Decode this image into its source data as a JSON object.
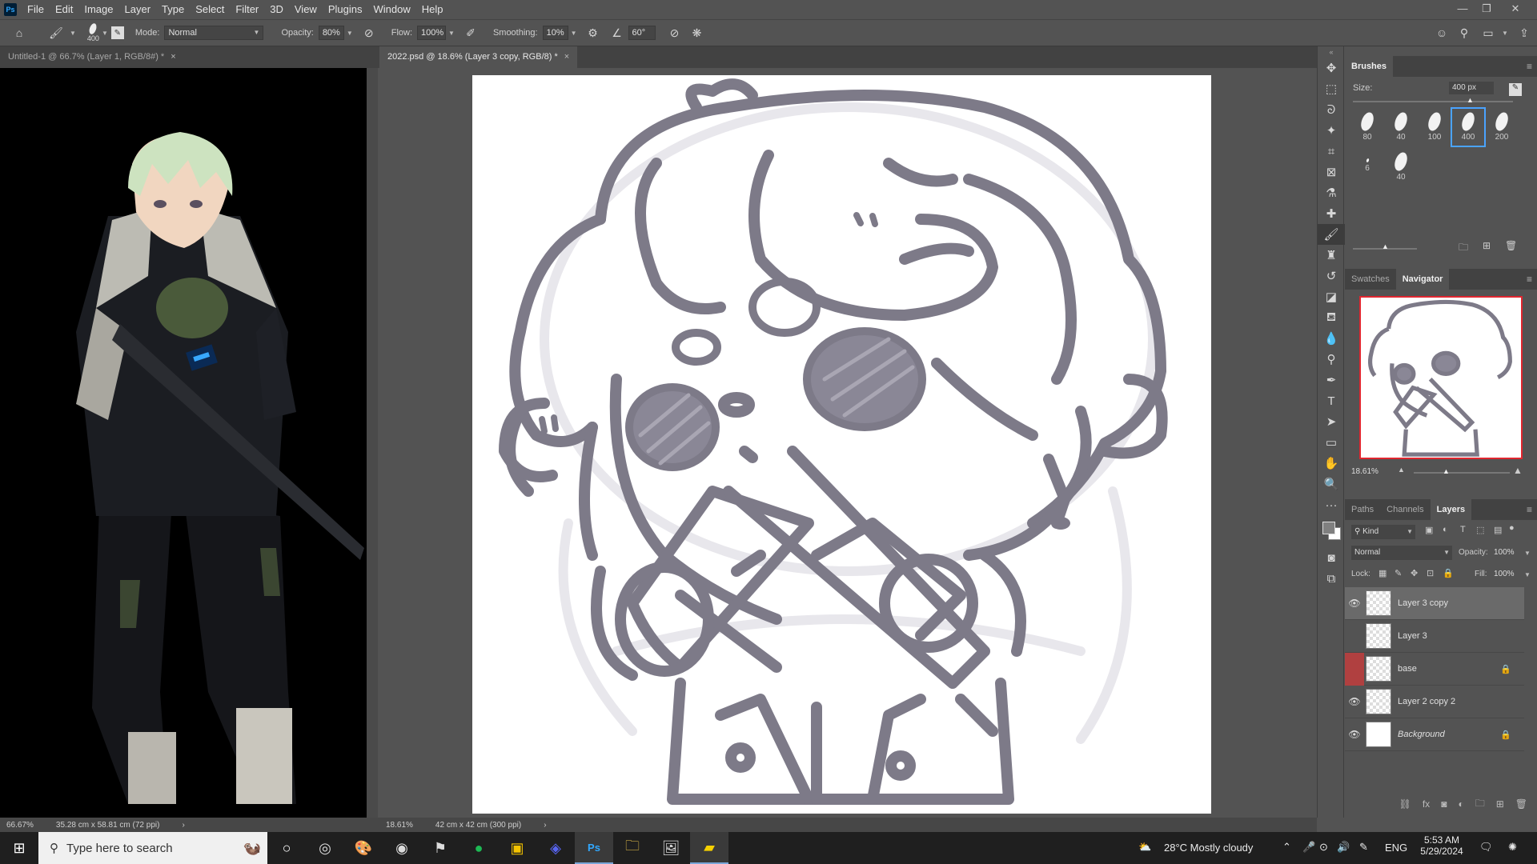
{
  "menubar": {
    "logo": "Ps",
    "items": [
      "File",
      "Edit",
      "Image",
      "Layer",
      "Type",
      "Select",
      "Filter",
      "3D",
      "View",
      "Plugins",
      "Window",
      "Help"
    ],
    "window_controls": [
      "—",
      "❐",
      "✕"
    ]
  },
  "options": {
    "brush_size": "400",
    "mode_label": "Mode:",
    "mode_value": "Normal",
    "opacity_label": "Opacity:",
    "opacity_value": "80%",
    "flow_label": "Flow:",
    "flow_value": "100%",
    "smoothing_label": "Smoothing:",
    "smoothing_value": "10%",
    "angle_value": "60°"
  },
  "tabs": [
    {
      "label": "Untitled-1 @ 66.7% (Layer 1, RGB/8#) *",
      "close": "×"
    },
    {
      "label": "2022.psd @ 18.6% (Layer 3 copy, RGB/8) *",
      "close": "×"
    }
  ],
  "status_left": {
    "zoom": "66.67%",
    "info": "35.28 cm x 58.81 cm (72 ppi)",
    "arrow": "›"
  },
  "status_center": {
    "zoom": "18.61%",
    "info": "42 cm x 42 cm (300 ppi)",
    "arrow": "›"
  },
  "brushes": {
    "title": "Brushes",
    "size_label": "Size:",
    "size_value": "400 px",
    "tips": [
      "80",
      "40",
      "100",
      "400",
      "200",
      "6",
      "40"
    ]
  },
  "navigator": {
    "tabs": [
      "Swatches",
      "Navigator"
    ],
    "zoom": "18.61%"
  },
  "layers": {
    "tabs": [
      "Paths",
      "Channels",
      "Layers"
    ],
    "filter_label": "Kind",
    "blend_mode": "Normal",
    "opacity_label": "Opacity:",
    "opacity_value": "100%",
    "lock_label": "Lock:",
    "fill_label": "Fill:",
    "fill_value": "100%",
    "items": [
      {
        "name": "Layer 3 copy"
      },
      {
        "name": "Layer 3"
      },
      {
        "name": "base"
      },
      {
        "name": "Layer 2 copy 2"
      },
      {
        "name": "Background"
      }
    ]
  },
  "taskbar": {
    "search_placeholder": "Type here to search",
    "weather": "28°C  Mostly cloudy",
    "language": "ENG",
    "time": "5:53 AM",
    "date": "5/29/2024"
  },
  "colors": {
    "accent": "#4aa3ff",
    "sketch": "#7d7a88",
    "sketch_faint": "#e8e7ec",
    "base_tag": "#b04040"
  }
}
